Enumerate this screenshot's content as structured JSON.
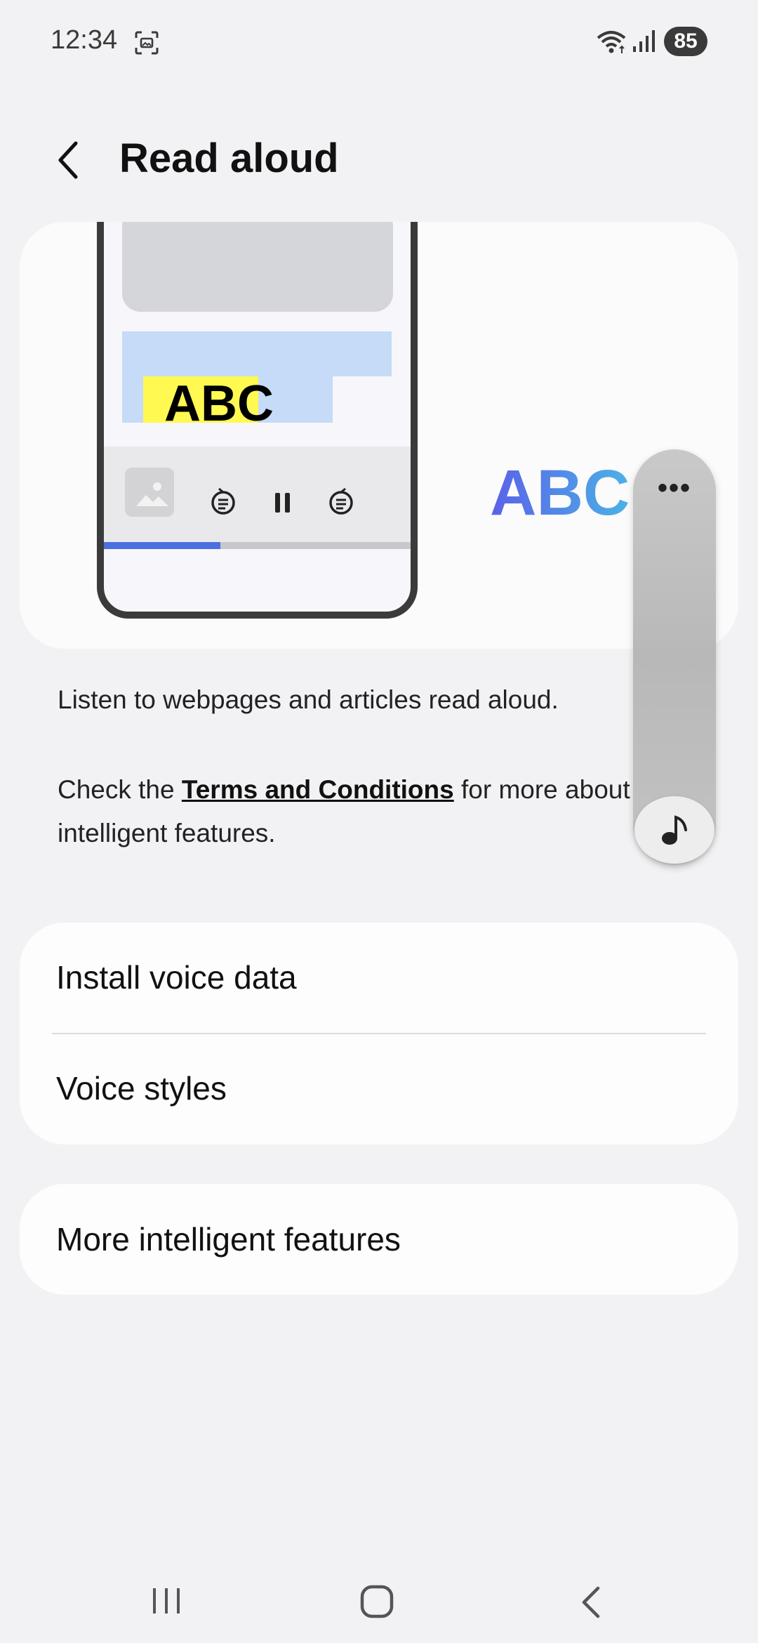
{
  "status_bar": {
    "time": "12:34",
    "battery": "85",
    "icons": [
      "screenshot-icon",
      "wifi-icon",
      "signal-icon",
      "battery-icon"
    ]
  },
  "header": {
    "title": "Read aloud",
    "back_icon": "chevron-left-icon"
  },
  "illustration": {
    "phone_text": "ABC",
    "voice_text": "ABC",
    "progress": 0.38,
    "colors": {
      "highlight": "#c5dbf7",
      "text_highlight": "#fff952",
      "progress": "#4a6fe0",
      "wave_start": "#5b61e8",
      "wave_end": "#6fe0c0"
    }
  },
  "floating_widget": {
    "more_label": "•••",
    "icons": [
      "more-icon",
      "music-note-icon"
    ]
  },
  "description": {
    "line1": "Listen to webpages and articles read aloud.",
    "line2_before": "Check the ",
    "terms_link": "Terms and Conditions",
    "line2_after": " for more about intelligent features."
  },
  "settings": {
    "group1": [
      {
        "label": "Install voice data"
      },
      {
        "label": "Voice styles"
      }
    ],
    "group2": [
      {
        "label": "More intelligent features"
      }
    ]
  },
  "navbar": {
    "icons": [
      "recents-icon",
      "home-icon",
      "back-icon"
    ]
  }
}
